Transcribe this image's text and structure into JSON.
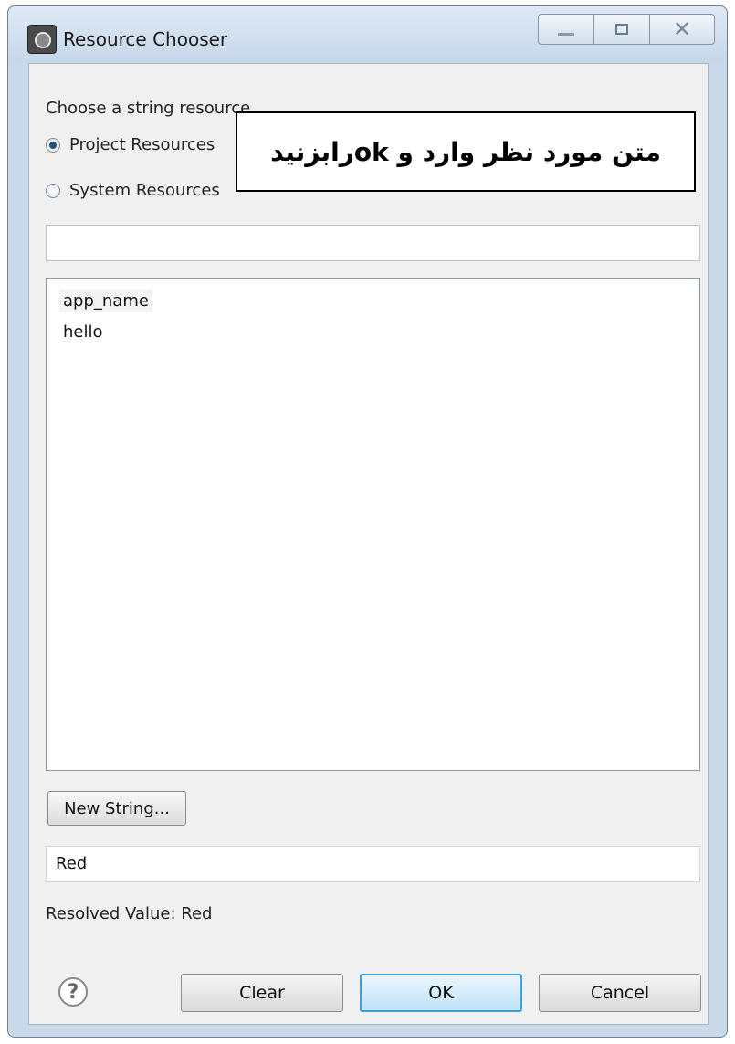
{
  "window": {
    "title": "Resource Chooser"
  },
  "dialog": {
    "prompt": "Choose a string resource",
    "radios": [
      {
        "label": "Project Resources",
        "checked": true
      },
      {
        "label": "System Resources",
        "checked": false
      }
    ],
    "filter_value": "",
    "list_items": [
      "app_name",
      "hello"
    ],
    "new_string_label": "New String...",
    "value_field": "Red",
    "resolved_value": "Resolved Value: Red",
    "buttons": {
      "clear": "Clear",
      "ok": "OK",
      "cancel": "Cancel"
    }
  },
  "annotation": {
    "text": "متن مورد نظر وارد و okرابزنید"
  },
  "colors": {
    "title_bar": "#c9d9ea",
    "ok_border": "#3c9fd8"
  }
}
